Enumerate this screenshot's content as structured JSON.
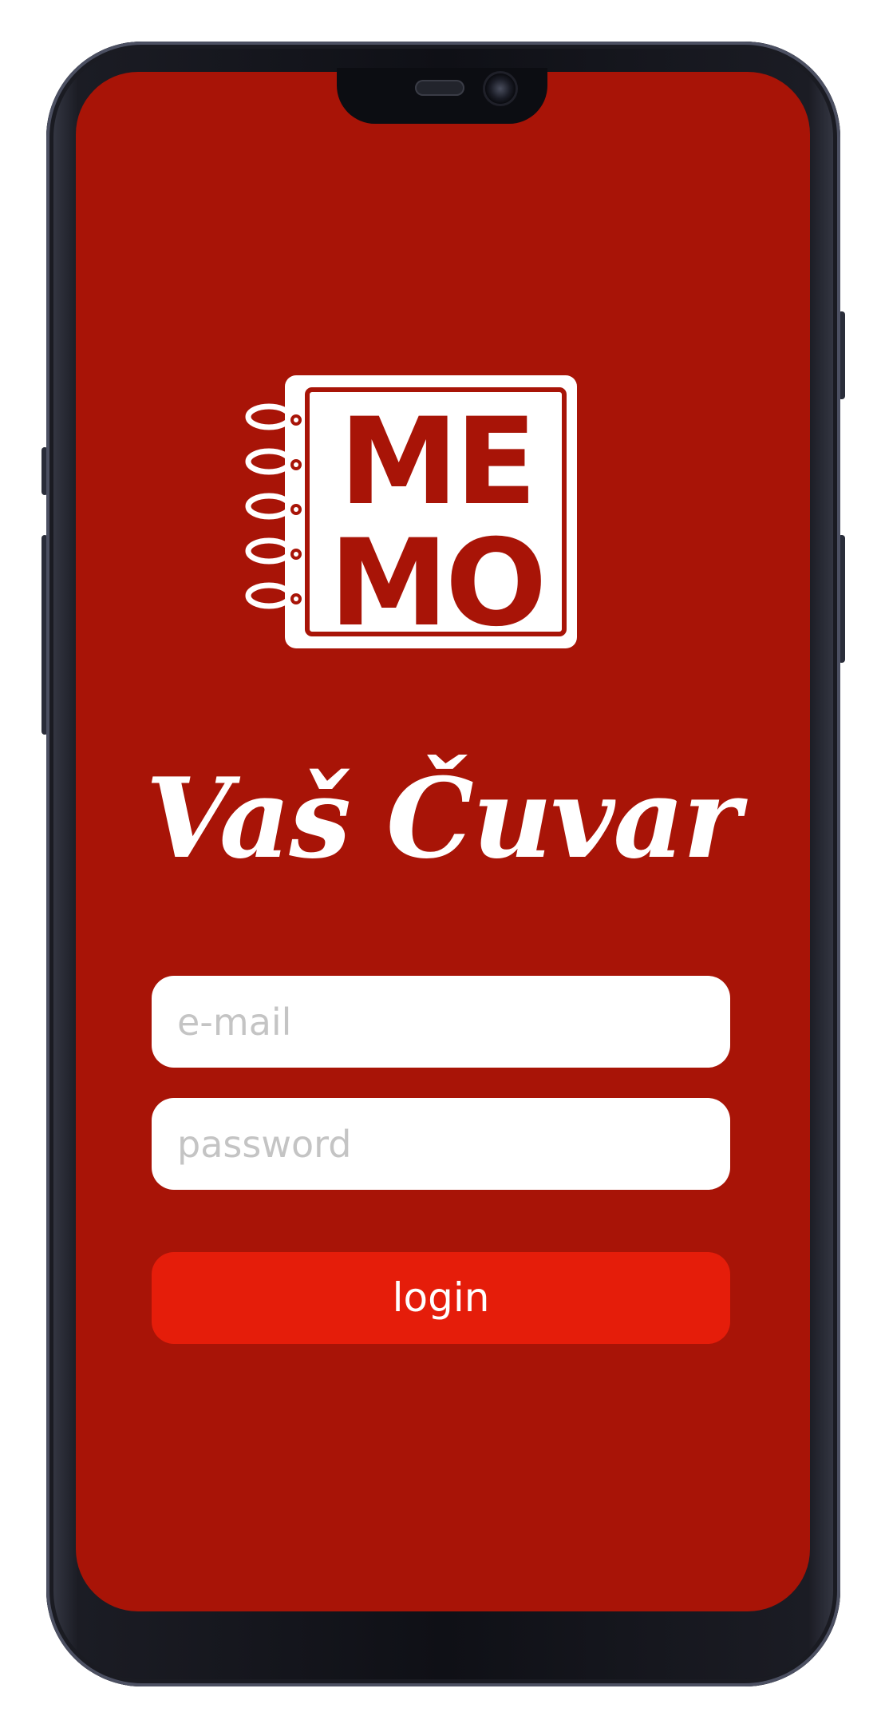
{
  "app": {
    "logo_text_top": "ME",
    "logo_text_bottom": "MO",
    "tagline": "Vaš Čuvar",
    "background_color": "#a81407",
    "accent_color": "#e51d0a"
  },
  "form": {
    "email_placeholder": "e-mail",
    "email_value": "",
    "password_placeholder": "password",
    "password_value": "",
    "login_label": "login"
  }
}
